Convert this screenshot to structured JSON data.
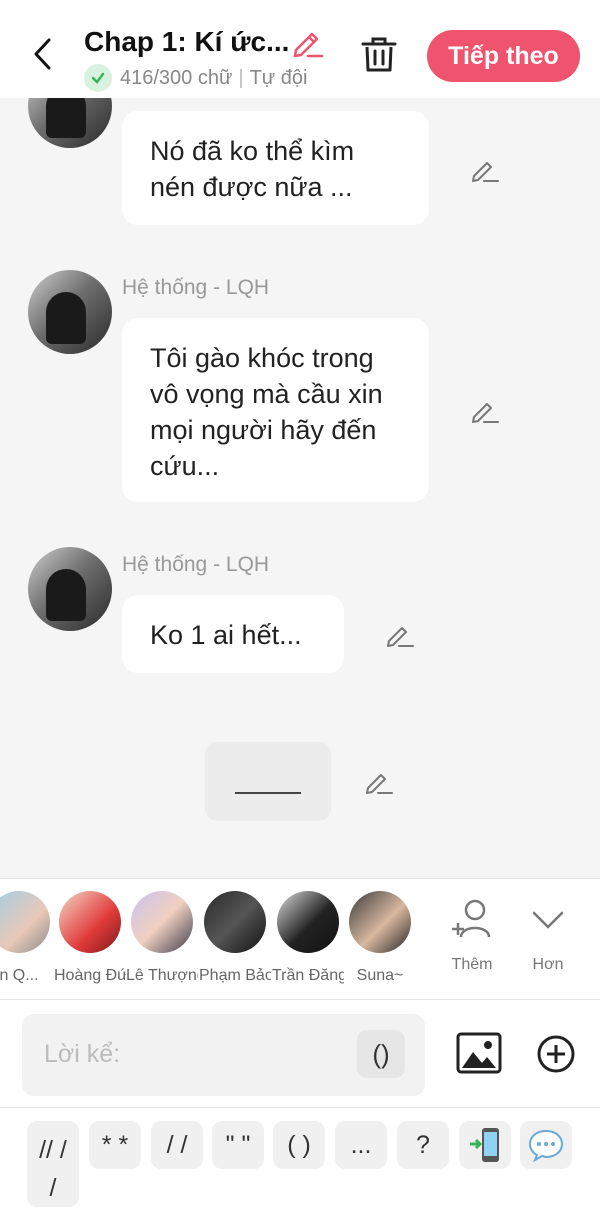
{
  "header": {
    "title": "Chap 1: Kí ức...",
    "word_count": "416/300 chữ",
    "team": "Tự đội",
    "next_label": "Tiếp theo"
  },
  "messages": [
    {
      "sender": "",
      "text": "Nó đã ko thể kìm nén được nữa ..."
    },
    {
      "sender": "Hệ thống - LQH",
      "text": "Tôi gào khóc trong vô vọng mà cầu xin mọi người hãy đến cứu..."
    },
    {
      "sender": "Hệ thống - LQH",
      "text": "Ko 1 ai hết..."
    }
  ],
  "characters": [
    {
      "name": "n Q..."
    },
    {
      "name": "Hoàng Đứ..."
    },
    {
      "name": "Lê Thượng..."
    },
    {
      "name": "Phạm Bảo..."
    },
    {
      "name": "Trần Đăng..."
    },
    {
      "name": "Suna~"
    }
  ],
  "actions": {
    "add_label": "Thêm",
    "more_label": "Hơn"
  },
  "input": {
    "placeholder": "Lời kể:",
    "paren": "()"
  },
  "toolbar": {
    "items": [
      "// /\n/",
      "* *",
      "/ /",
      "\" \"",
      "( )",
      "...",
      "?"
    ]
  },
  "colors": {
    "accent": "#f0536d",
    "check": "#3bb35b"
  }
}
